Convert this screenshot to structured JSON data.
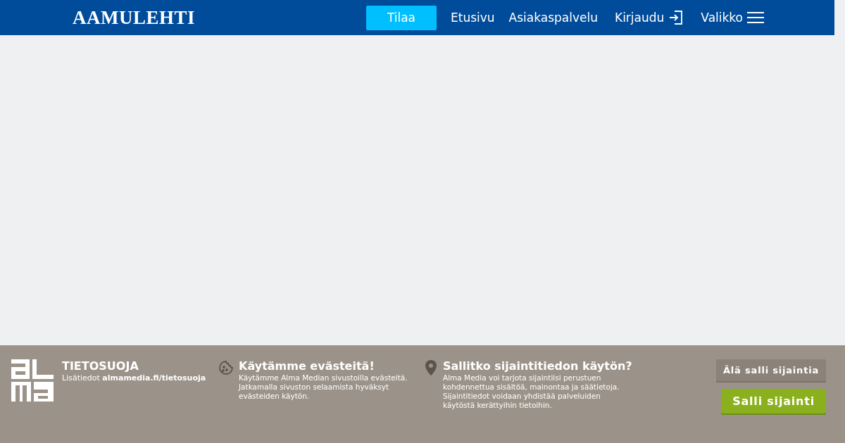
{
  "header": {
    "logo": "AAMULEHTI",
    "subscribe": "Tilaa",
    "nav": [
      {
        "label": "Etusivu",
        "kind": "link"
      },
      {
        "label": "Asiakaspalvelu",
        "kind": "link"
      },
      {
        "label": "Kirjaudu",
        "kind": "login"
      },
      {
        "label": "Valikko",
        "kind": "menu"
      }
    ]
  },
  "consent": {
    "privacy": {
      "title": "TIETOSUOJA",
      "text": "Lisätiedot **almamedia.fi/tietosuoja**"
    },
    "cookies": {
      "title": "Käytämme evästeitä!",
      "text": "Käytämme Alma Median sivustoilla evästeitä. Jatkamalla sivuston selaamista hyväksyt evästeiden käytön."
    },
    "location": {
      "title": "Sallitko sijaintitiedon käytön?",
      "text": "Alma Media voi tarjota sijaintiisi perustuen kohdennettua sisältöä, mainontaa ja säätietoja. Sijaintitiedot voidaan yhdistää palveluiden käytöstä kerättyihin tietoihin."
    },
    "buttons": [
      {
        "label": "Älä salli sijaintia",
        "kind": "deny"
      },
      {
        "label": "Salli sijainti",
        "kind": "allow"
      }
    ]
  }
}
